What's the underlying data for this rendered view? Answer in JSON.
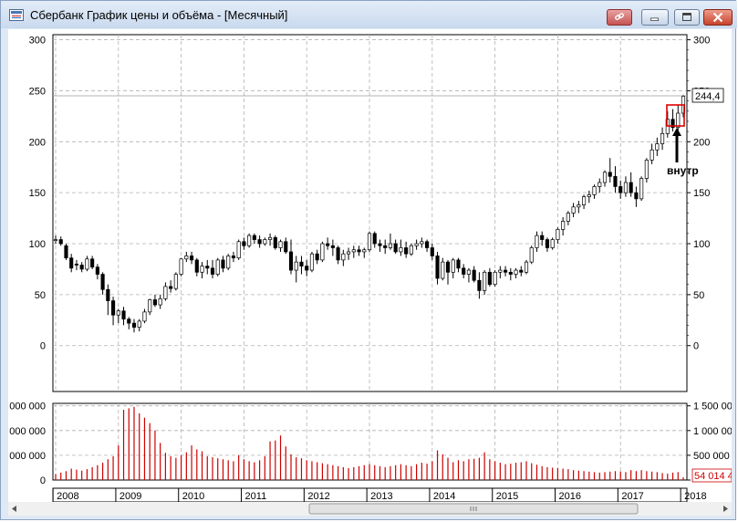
{
  "window": {
    "title": "Сбербанк График цены и объёма - [Месячный]"
  },
  "titlebar_buttons": [
    {
      "name": "link-button",
      "icon": "link-icon"
    },
    {
      "name": "minimize-button",
      "icon": "minimize-icon"
    },
    {
      "name": "maximize-button",
      "icon": "maximize-icon"
    },
    {
      "name": "close-button",
      "icon": "close-icon"
    }
  ],
  "colors": {
    "volume": "#cc0000",
    "candle": "#000000",
    "grid": "#b0b0b0",
    "highlight": "#e00000"
  },
  "price_panel": {
    "y_ticks": [
      "300",
      "250",
      "200",
      "150",
      "100",
      "50",
      "0"
    ],
    "ylim": [
      -45,
      305
    ],
    "last_price_label": "244,4",
    "annotation": "внутр"
  },
  "volume_panel": {
    "y_ticks_left": [
      "000 000",
      "000 000",
      "000 000",
      "0"
    ],
    "y_ticks_right": [
      "1 500 000",
      "1 000 000",
      "500 000",
      "0"
    ],
    "last_volume_label": "54 014 4"
  },
  "x_axis": {
    "years": [
      "2008",
      "2009",
      "2010",
      "2011",
      "2012",
      "2013",
      "2014",
      "2015",
      "2016",
      "2017",
      "2018"
    ]
  },
  "chart_data": {
    "type": "candlestick",
    "period": "monthly",
    "first_month": "2008-01",
    "candles": [
      [
        103,
        108,
        100,
        104
      ],
      [
        104,
        107,
        98,
        100
      ],
      [
        98,
        100,
        84,
        86
      ],
      [
        86,
        90,
        72,
        76
      ],
      [
        80,
        84,
        74,
        79
      ],
      [
        79,
        82,
        72,
        75
      ],
      [
        75,
        88,
        73,
        85
      ],
      [
        85,
        88,
        75,
        77
      ],
      [
        77,
        80,
        65,
        70
      ],
      [
        70,
        72,
        50,
        55
      ],
      [
        55,
        60,
        30,
        44
      ],
      [
        44,
        48,
        20,
        30
      ],
      [
        30,
        36,
        22,
        34
      ],
      [
        34,
        38,
        20,
        26
      ],
      [
        26,
        28,
        16,
        22
      ],
      [
        22,
        26,
        13,
        18
      ],
      [
        18,
        26,
        14,
        24
      ],
      [
        24,
        36,
        22,
        33
      ],
      [
        33,
        46,
        30,
        45
      ],
      [
        45,
        50,
        38,
        40
      ],
      [
        40,
        50,
        36,
        46
      ],
      [
        46,
        62,
        44,
        58
      ],
      [
        58,
        64,
        52,
        56
      ],
      [
        56,
        72,
        54,
        70
      ],
      [
        70,
        86,
        68,
        85
      ],
      [
        85,
        92,
        82,
        88
      ],
      [
        88,
        92,
        80,
        84
      ],
      [
        84,
        86,
        68,
        72
      ],
      [
        72,
        82,
        66,
        78
      ],
      [
        78,
        84,
        70,
        76
      ],
      [
        76,
        84,
        66,
        70
      ],
      [
        70,
        86,
        68,
        84
      ],
      [
        84,
        88,
        72,
        76
      ],
      [
        76,
        90,
        74,
        88
      ],
      [
        88,
        92,
        82,
        86
      ],
      [
        86,
        104,
        84,
        102
      ],
      [
        102,
        106,
        94,
        98
      ],
      [
        98,
        110,
        96,
        108
      ],
      [
        108,
        110,
        100,
        104
      ],
      [
        104,
        108,
        96,
        100
      ],
      [
        100,
        106,
        98,
        104
      ],
      [
        104,
        110,
        98,
        106
      ],
      [
        106,
        108,
        94,
        96
      ],
      [
        96,
        104,
        92,
        102
      ],
      [
        102,
        106,
        90,
        92
      ],
      [
        92,
        104,
        70,
        74
      ],
      [
        74,
        88,
        62,
        82
      ],
      [
        82,
        88,
        70,
        78
      ],
      [
        78,
        84,
        68,
        74
      ],
      [
        74,
        92,
        72,
        90
      ],
      [
        90,
        94,
        80,
        84
      ],
      [
        84,
        102,
        82,
        100
      ],
      [
        100,
        106,
        94,
        98
      ],
      [
        98,
        104,
        88,
        96
      ],
      [
        96,
        98,
        80,
        84
      ],
      [
        84,
        94,
        78,
        90
      ],
      [
        90,
        96,
        84,
        92
      ],
      [
        92,
        98,
        86,
        94
      ],
      [
        94,
        98,
        88,
        92
      ],
      [
        92,
        96,
        86,
        94
      ],
      [
        94,
        112,
        92,
        110
      ],
      [
        110,
        112,
        96,
        100
      ],
      [
        100,
        104,
        92,
        98
      ],
      [
        98,
        104,
        90,
        96
      ],
      [
        96,
        110,
        94,
        100
      ],
      [
        100,
        104,
        90,
        92
      ],
      [
        92,
        104,
        88,
        96
      ],
      [
        96,
        102,
        86,
        90
      ],
      [
        90,
        100,
        88,
        98
      ],
      [
        98,
        104,
        94,
        100
      ],
      [
        100,
        106,
        96,
        102
      ],
      [
        102,
        104,
        92,
        96
      ],
      [
        96,
        100,
        84,
        88
      ],
      [
        88,
        92,
        60,
        66
      ],
      [
        66,
        86,
        64,
        82
      ],
      [
        82,
        84,
        60,
        72
      ],
      [
        72,
        86,
        66,
        84
      ],
      [
        84,
        86,
        72,
        76
      ],
      [
        76,
        80,
        66,
        70
      ],
      [
        70,
        76,
        62,
        74
      ],
      [
        74,
        78,
        62,
        64
      ],
      [
        64,
        72,
        46,
        54
      ],
      [
        54,
        74,
        50,
        72
      ],
      [
        72,
        76,
        58,
        60
      ],
      [
        60,
        74,
        58,
        72
      ],
      [
        72,
        78,
        66,
        74
      ],
      [
        74,
        78,
        68,
        72
      ],
      [
        72,
        76,
        64,
        70
      ],
      [
        70,
        76,
        66,
        74
      ],
      [
        74,
        78,
        68,
        72
      ],
      [
        72,
        84,
        70,
        82
      ],
      [
        82,
        98,
        80,
        96
      ],
      [
        96,
        112,
        92,
        108
      ],
      [
        108,
        112,
        98,
        104
      ],
      [
        104,
        106,
        92,
        96
      ],
      [
        96,
        106,
        94,
        104
      ],
      [
        104,
        116,
        100,
        114
      ],
      [
        114,
        126,
        108,
        122
      ],
      [
        122,
        132,
        118,
        130
      ],
      [
        130,
        140,
        126,
        136
      ],
      [
        136,
        142,
        130,
        138
      ],
      [
        138,
        148,
        134,
        146
      ],
      [
        146,
        152,
        140,
        148
      ],
      [
        148,
        158,
        144,
        156
      ],
      [
        156,
        164,
        150,
        160
      ],
      [
        160,
        172,
        156,
        170
      ],
      [
        170,
        184,
        160,
        166
      ],
      [
        166,
        176,
        150,
        156
      ],
      [
        156,
        162,
        144,
        150
      ],
      [
        150,
        166,
        146,
        160
      ],
      [
        160,
        170,
        146,
        150
      ],
      [
        150,
        156,
        136,
        144
      ],
      [
        144,
        166,
        142,
        164
      ],
      [
        164,
        184,
        160,
        182
      ],
      [
        182,
        198,
        178,
        192
      ],
      [
        192,
        204,
        186,
        198
      ],
      [
        198,
        214,
        192,
        208
      ],
      [
        208,
        230,
        204,
        222
      ],
      [
        222,
        232,
        210,
        214
      ],
      [
        214,
        236,
        210,
        228
      ],
      [
        228,
        246,
        224,
        244.4
      ]
    ],
    "volume": [
      120000,
      150000,
      180000,
      230000,
      210000,
      190000,
      220000,
      260000,
      300000,
      350000,
      420000,
      480000,
      700000,
      1420000,
      1450000,
      1480000,
      1350000,
      1260000,
      1150000,
      1000000,
      750000,
      550000,
      480000,
      450000,
      500000,
      560000,
      700000,
      620000,
      580000,
      480000,
      460000,
      440000,
      420000,
      400000,
      380000,
      500000,
      420000,
      380000,
      360000,
      400000,
      480000,
      780000,
      800000,
      900000,
      680000,
      520000,
      460000,
      440000,
      400000,
      380000,
      360000,
      340000,
      320000,
      300000,
      280000,
      260000,
      240000,
      260000,
      280000,
      300000,
      320000,
      300000,
      280000,
      260000,
      280000,
      300000,
      320000,
      300000,
      280000,
      320000,
      350000,
      330000,
      380000,
      600000,
      520000,
      450000,
      360000,
      400000,
      380000,
      420000,
      430000,
      450000,
      560000,
      420000,
      380000,
      350000,
      320000,
      330000,
      350000,
      360000,
      380000,
      340000,
      310000,
      280000,
      260000,
      250000,
      240000,
      230000,
      220000,
      200000,
      190000,
      180000,
      170000,
      160000,
      150000,
      160000,
      170000,
      180000,
      175000,
      160000,
      200000,
      180000,
      200000,
      180000,
      170000,
      160000,
      140000,
      130000,
      150000,
      160000,
      54014
    ],
    "y_ticks": [
      0,
      50,
      100,
      150,
      200,
      250,
      300
    ],
    "volume_ticks": [
      0,
      500000,
      1000000,
      1500000
    ],
    "ylim": [
      -45,
      305
    ],
    "volume_ylim": [
      0,
      1550000
    ]
  }
}
